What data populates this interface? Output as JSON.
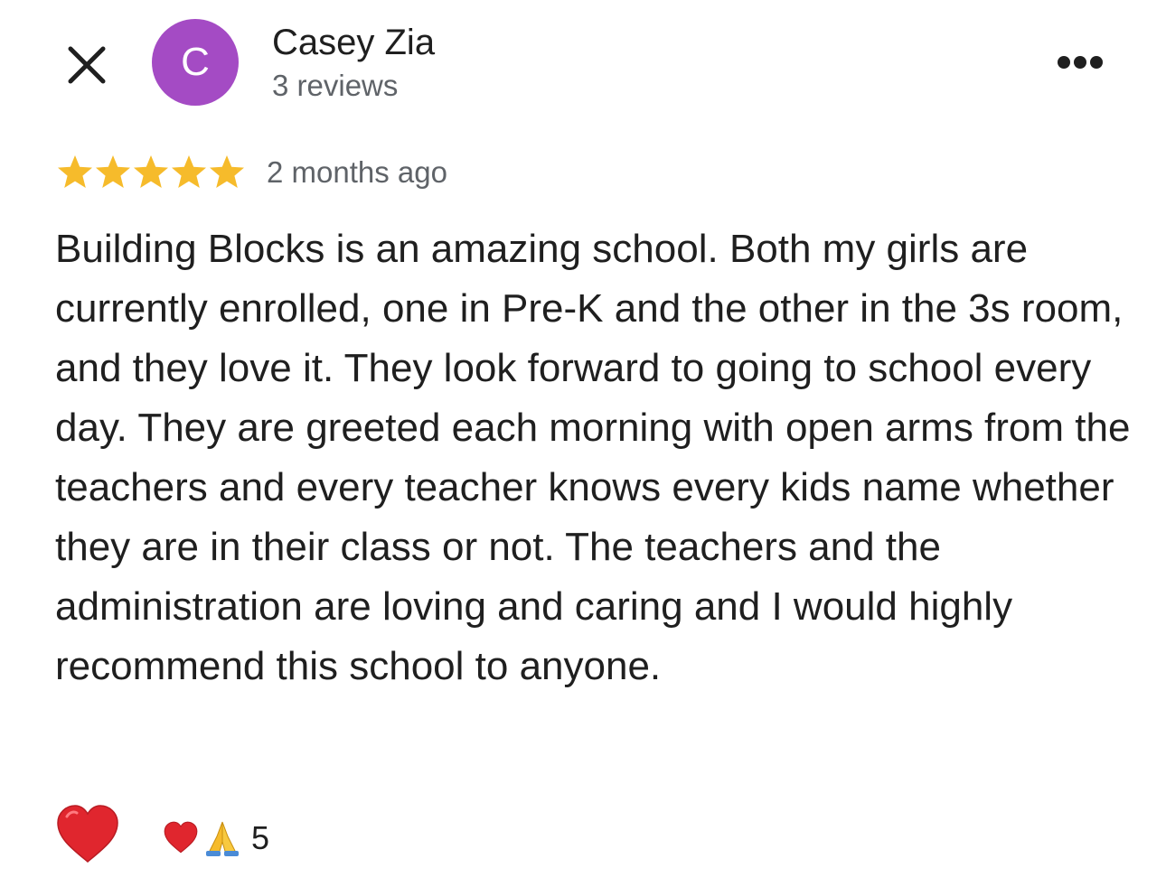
{
  "header": {
    "close_icon": "close-icon",
    "avatar_letter": "C",
    "avatar_color": "#a44bc4",
    "author_name": "Casey Zia",
    "review_count": "3 reviews",
    "more_icon": "more-horizontal-icon"
  },
  "review": {
    "rating": 5,
    "rating_max": 5,
    "star_color": "#f6bb2b",
    "time_ago": "2 months ago",
    "text": "Building Blocks is an amazing school. Both my girls are currently enrolled, one in Pre-K and the other in the 3s room, and they love it. They look forward to going to school every day. They are greeted each morning with open arms from the teachers and every teacher knows every kids name whether they are in their class or not. The teachers and the administration are loving and caring and I would highly recommend this school to anyone."
  },
  "reactions": {
    "like_icon": "heart-icon",
    "summary_icons": [
      "heart-icon",
      "folded-hands-icon"
    ],
    "count": "5"
  }
}
